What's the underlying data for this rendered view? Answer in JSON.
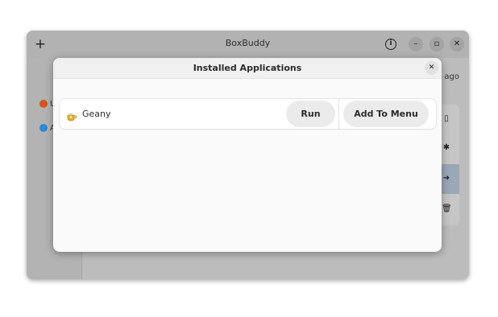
{
  "main_window": {
    "title": "BoxBuddy",
    "add_symbol": "+",
    "info_symbol": "i",
    "minimize_symbol": "–",
    "maximize_symbol": "▫",
    "close_symbol": "✕",
    "sidebar": {
      "items": [
        {
          "label": "U",
          "color": "#d9531e"
        },
        {
          "label": "A",
          "color": "#2a8bd6"
        }
      ]
    },
    "time_text": "s ago",
    "action_icons": [
      "▯",
      "✱",
      "➜",
      "🗑"
    ]
  },
  "dialog": {
    "title": "Installed Applications",
    "close_symbol": "✕",
    "apps": [
      {
        "name": "Geany",
        "icon": "geany-teacup-icon",
        "run_label": "Run",
        "add_menu_label": "Add To Menu"
      }
    ]
  }
}
